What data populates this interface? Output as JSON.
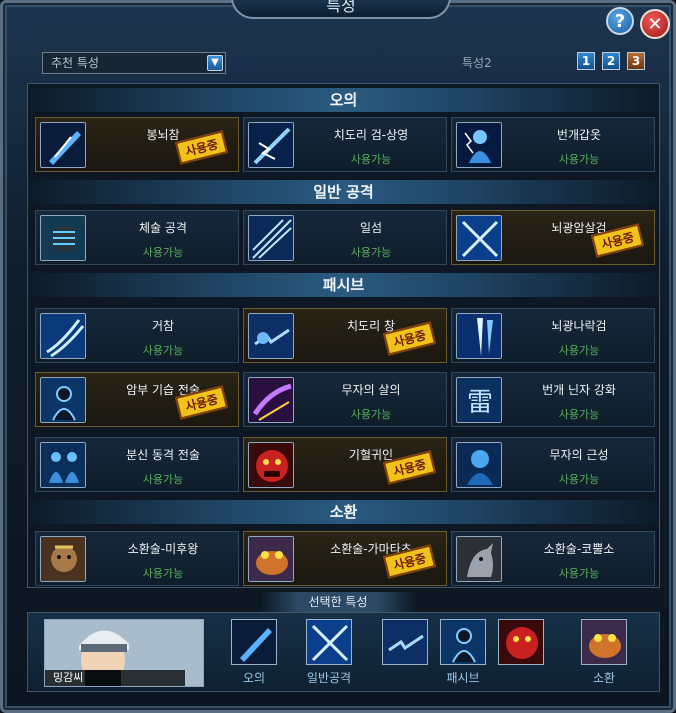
{
  "window": {
    "title": "특성"
  },
  "toolbar": {
    "preset_value": "추천 특성",
    "set_label": "특성2",
    "pages": [
      "1",
      "2",
      "3"
    ],
    "active_page": "3"
  },
  "sections": {
    "ougi": {
      "title": "오의"
    },
    "normal": {
      "title": "일반 공격"
    },
    "passive": {
      "title": "패시브"
    },
    "summon": {
      "title": "소환"
    }
  },
  "skills": {
    "s1": {
      "name": "봉뇌참",
      "badge": "사용중"
    },
    "s2": {
      "name": "치도리 검-상영",
      "status": "사용가능"
    },
    "s3": {
      "name": "번개갑옷",
      "status": "사용가능"
    },
    "s4": {
      "name": "체술 공격",
      "status": "사용가능"
    },
    "s5": {
      "name": "일섬",
      "status": "사용가능"
    },
    "s6": {
      "name": "뇌광암살검",
      "badge": "사용중"
    },
    "s7": {
      "name": "거참",
      "status": "사용가능"
    },
    "s8": {
      "name": "치도리 창",
      "badge": "사용중"
    },
    "s9": {
      "name": "뇌광나락검",
      "status": "사용가능"
    },
    "s10": {
      "name": "암부 기습 전술",
      "badge": "사용중"
    },
    "s11": {
      "name": "무자의 살의",
      "status": "사용가능"
    },
    "s12": {
      "name": "번개 닌자 강화",
      "status": "사용가능"
    },
    "s13": {
      "name": "분신 동격 전술",
      "status": "사용가능"
    },
    "s14": {
      "name": "기혈귀인",
      "badge": "사용중"
    },
    "s15": {
      "name": "무자의 근성",
      "status": "사용가능"
    },
    "s16": {
      "name": "소환술-미후왕",
      "status": "사용가능"
    },
    "s17": {
      "name": "소환술-가마타츠",
      "badge": "사용중"
    },
    "s18": {
      "name": "소환술-코뿔소",
      "status": "사용가능"
    }
  },
  "selected": {
    "title": "선택한 특성",
    "character_name": "밍감씨",
    "categories": {
      "ougi": "오의",
      "normal": "일반공격",
      "passive": "패시브",
      "summon": "소환"
    }
  },
  "colors": {
    "available": "#58b05d",
    "stamp": "#f0c21a",
    "accent": "#2a5a80"
  }
}
